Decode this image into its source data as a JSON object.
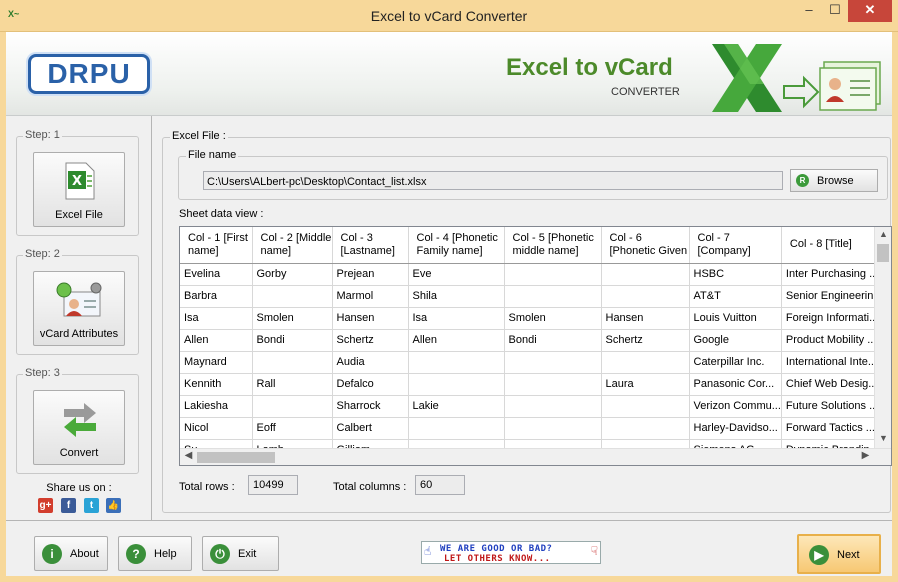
{
  "window": {
    "title": "Excel to vCard Converter",
    "app_icon": "x-icon",
    "minimize": "–",
    "maximize": "☐",
    "close": "✕"
  },
  "header": {
    "logo": "DRPU",
    "brand_title": "Excel to vCard",
    "brand_subtitle": "CONVERTER",
    "brand_art_icon": "excel-to-vcard-art-icon"
  },
  "steps": [
    {
      "label": "Step: 1",
      "button": "Excel File",
      "icon": "excel-file-icon"
    },
    {
      "label": "Step: 2",
      "button": "vCard Attributes",
      "icon": "vcard-attributes-icon"
    },
    {
      "label": "Step: 3",
      "button": "Convert",
      "icon": "convert-arrows-icon"
    }
  ],
  "share": {
    "label": "Share us on :",
    "icons": [
      {
        "name": "google-plus-icon",
        "glyph": "g+",
        "color": "#d23d2d"
      },
      {
        "name": "facebook-icon",
        "glyph": "f",
        "color": "#3b5b98"
      },
      {
        "name": "twitter-icon",
        "glyph": "t",
        "color": "#2aa3d6"
      },
      {
        "name": "thumbs-up-icon",
        "glyph": "👍",
        "color": "#3b6fb8"
      }
    ]
  },
  "main": {
    "excel_file_legend": "Excel File :",
    "file_name_legend": "File name",
    "file_path": "C:\\Users\\ALbert-pc\\Desktop\\Contact_list.xlsx",
    "browse_label": "Browse",
    "sheet_label": "Sheet data view :",
    "total_rows_label": "Total rows :",
    "total_rows": "10499",
    "total_columns_label": "Total columns :",
    "total_columns": "60"
  },
  "grid": {
    "columns": [
      "Col - 1 [First name]",
      "Col - 2 [Middle name]",
      "Col - 3 [Lastname]",
      "Col - 4 [Phonetic Family name]",
      "Col - 5 [Phonetic middle name]",
      "Col - 6 [Phonetic Given",
      "Col - 7 [Company]",
      "Col - 8 [Title]"
    ],
    "rows": [
      [
        "Evelina",
        "Gorby",
        "Prejean",
        "Eve",
        "",
        "",
        "HSBC",
        "Inter Purchasing ..."
      ],
      [
        "Barbra",
        "",
        "Marmol",
        "Shila",
        "",
        "",
        "AT&T",
        "Senior Engineerin..."
      ],
      [
        "Isa",
        "Smolen",
        "Hansen",
        "Isa",
        "Smolen",
        "Hansen",
        "Louis Vuitton",
        "Foreign Informati..."
      ],
      [
        "Allen",
        "Bondi",
        "Schertz",
        "Allen",
        "Bondi",
        "Schertz",
        "Google",
        "Product Mobility ..."
      ],
      [
        "Maynard",
        "",
        "Audia",
        "",
        "",
        "",
        "Caterpillar Inc.",
        "International Inte..."
      ],
      [
        "Kennith",
        "Rall",
        "Defalco",
        "",
        "",
        "Laura",
        "Panasonic Cor...",
        "Chief Web Desig..."
      ],
      [
        "Lakiesha",
        "",
        "Sharrock",
        "Lakie",
        "",
        "",
        "Verizon Commu...",
        "Future Solutions ..."
      ],
      [
        "Nicol",
        "Eoff",
        "Calbert",
        "",
        "",
        "",
        "Harley-Davidso...",
        "Forward Tactics ..."
      ],
      [
        "Su",
        "Lamb",
        "Gilliam",
        "",
        "",
        "",
        "Siemens AG",
        "Dynamic Brandin..."
      ]
    ]
  },
  "footer": {
    "about": "About",
    "help": "Help",
    "exit": "Exit",
    "next": "Next",
    "rate_line1": "WE ARE GOOD OR BAD?",
    "rate_line2": "LET OTHERS KNOW..."
  }
}
